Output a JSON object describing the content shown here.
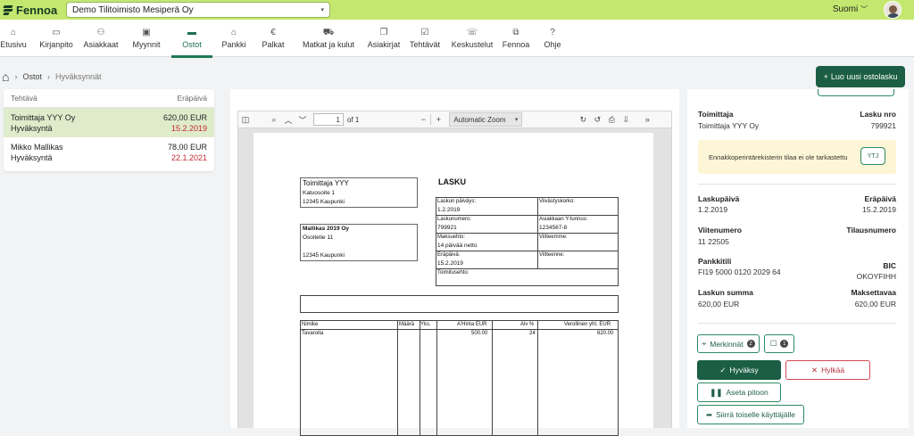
{
  "app": {
    "brand": "Fennoa",
    "company": "Demo Tilitoimisto Mesiperä Oy",
    "language": "Suomi"
  },
  "nav": [
    {
      "label": "Etusivu",
      "icon": "⌂"
    },
    {
      "label": "Kirjanpito",
      "icon": "▭"
    },
    {
      "label": "Asiakkaat",
      "icon": "⚇"
    },
    {
      "label": "Myynnit",
      "icon": "▣"
    },
    {
      "label": "Ostot",
      "icon": "▬"
    },
    {
      "label": "Pankki",
      "icon": "⌂"
    },
    {
      "label": "Palkat",
      "icon": "€"
    },
    {
      "label": "Matkat ja kulut",
      "icon": "⛟"
    },
    {
      "label": "Asiakirjat",
      "icon": "❐"
    },
    {
      "label": "Tehtävät",
      "icon": "☑"
    },
    {
      "label": "Keskustelut",
      "icon": "☏"
    },
    {
      "label": "Fennoa",
      "icon": "⧉"
    },
    {
      "label": "Ohje",
      "icon": "?"
    }
  ],
  "breadcrumb": {
    "items": [
      "Ostot",
      "Hyväksynnät"
    ]
  },
  "new_purchase_button": "Luo uusi ostolasku",
  "task_list": {
    "headers": {
      "task": "Tehtävä",
      "due": "Eräpäivä"
    },
    "rows": [
      {
        "name": "Toimittaja YYY Oy",
        "amount": "620,00 EUR",
        "status": "Hyväksyntä",
        "due": "15.2.2019"
      },
      {
        "name": "Mikko Mallikas",
        "amount": "78,00 EUR",
        "status": "Hyväksyntä",
        "due": "22.1.2021"
      }
    ]
  },
  "pdf_toolbar": {
    "page": "1",
    "of": "of 1",
    "zoom": "Automatic Zoom"
  },
  "invoice_doc": {
    "sender_name": "Toimittaja YYY",
    "sender_street": "Katuosoite 1",
    "sender_city": "12345 Kaupunki",
    "title": "LASKU",
    "recipient_name": "Mallikas 2019 Oy",
    "recipient_street": "Osoitetie 11",
    "recipient_city": "12345 Kaupunki",
    "f_date_label": "Laskun päiväys:",
    "f_date": "1.2.2019",
    "f_late_label": "Viivästyskorko:",
    "f_num_label": "Laskunumero:",
    "f_num": "799921",
    "f_ytunnus_label": "Asiakkaan Y-tunnus:",
    "f_ytunnus": "1234567-8",
    "f_terms_label": "Maksuehto:",
    "f_terms": "14 päivää netto",
    "f_ourref_label": "Viitteemme:",
    "f_due_label": "Eräpäivä:",
    "f_due": "15.2.2019",
    "f_yourref_label": "Viitteenne:",
    "f_delivery_label": "Toimitusehto:",
    "th_item": "Nimike",
    "th_qty": "Määrä",
    "th_unit": "Yks.",
    "th_price": "A'Hinta EUR",
    "th_vat": "Alv %",
    "th_total": "Verollinen yht. EUR",
    "row_item": "Tavaroita",
    "row_price": "500.00",
    "row_vat": "24",
    "row_total": "620.00"
  },
  "details": {
    "supplier_label": "Toimittaja",
    "supplier": "Toimittaja YYY Oy",
    "invoice_no_label": "Lasku nro",
    "invoice_no": "799921",
    "notice": "Ennakkoperintärekisterin tilaa ei ole tarkastettu",
    "ytj_button": "YTJ",
    "invoice_date_label": "Laskupäivä",
    "invoice_date": "1.2.2019",
    "due_label": "Eräpäivä",
    "due": "15.2.2019",
    "reference_label": "Viitenumero",
    "reference": "11 22505",
    "order_label": "Tilausnumero",
    "bank_label": "Pankkitili",
    "bank": "FI19 5000 0120 2029 64",
    "bic_label": "BIC",
    "bic": "OKOYFIHH",
    "sum_label": "Laskun summa",
    "sum": "620,00 EUR",
    "payable_label": "Maksettavaa",
    "payable": "620,00 EUR"
  },
  "actions": {
    "notes_label": "Merkinnät",
    "notes_count": "2",
    "comments_count": "1",
    "approve": "Hyväksy",
    "reject": "Hylkää",
    "hold": "Aseta pitoon",
    "transfer": "Siirrä toiselle käyttäjälle"
  },
  "colors": {
    "topbar": "#c4e86f",
    "primary": "#1b5e45",
    "selected_row": "#dfeccc",
    "due_red": "#c0282f",
    "reject_red": "#b8303c"
  }
}
